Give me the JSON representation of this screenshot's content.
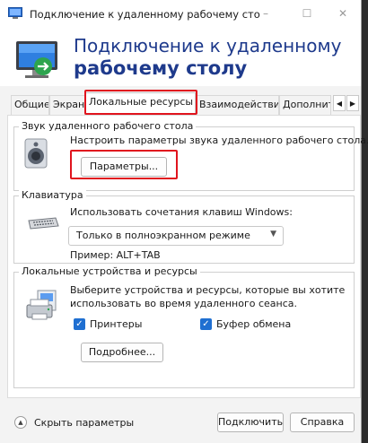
{
  "window": {
    "title": "Подключение к удаленному рабочему сто",
    "controls": {
      "minimize": "–",
      "maximize": "☐",
      "close": "✕"
    }
  },
  "header": {
    "line1": "Подключение к удаленному",
    "line2": "рабочему столу"
  },
  "tabs": {
    "items": [
      {
        "label": "Общие"
      },
      {
        "label": "Экран"
      },
      {
        "label": "Локальные ресурсы",
        "active": true
      },
      {
        "label": "Взаимодействие"
      },
      {
        "label": "Дополнит"
      }
    ],
    "scroll_left": "◀",
    "scroll_right": "▶"
  },
  "sound": {
    "group_title": "Звук удаленного рабочего стола",
    "description": "Настроить параметры звука удаленного рабочего стола.",
    "button": "Параметры..."
  },
  "keyboard": {
    "group_title": "Клавиатура",
    "description": "Использовать сочетания клавиш Windows:",
    "selected_option": "Только в полноэкранном режиме",
    "example": "Пример: ALT+TAB"
  },
  "devices": {
    "group_title": "Локальные устройства и ресурсы",
    "description_line1": "Выберите устройства и ресурсы, которые вы хотите",
    "description_line2": "использовать во время удаленного сеанса.",
    "printers_label": "Принтеры",
    "printers_checked": true,
    "clipboard_label": "Буфер обмена",
    "clipboard_checked": true,
    "more_button": "Подробнее..."
  },
  "footer": {
    "collapse_label": "Скрыть параметры",
    "connect_button": "Подключить",
    "help_button": "Справка"
  },
  "colors": {
    "header_text": "#1e3a8c",
    "highlight": "#e0141e",
    "checkbox": "#1f6fd1"
  }
}
